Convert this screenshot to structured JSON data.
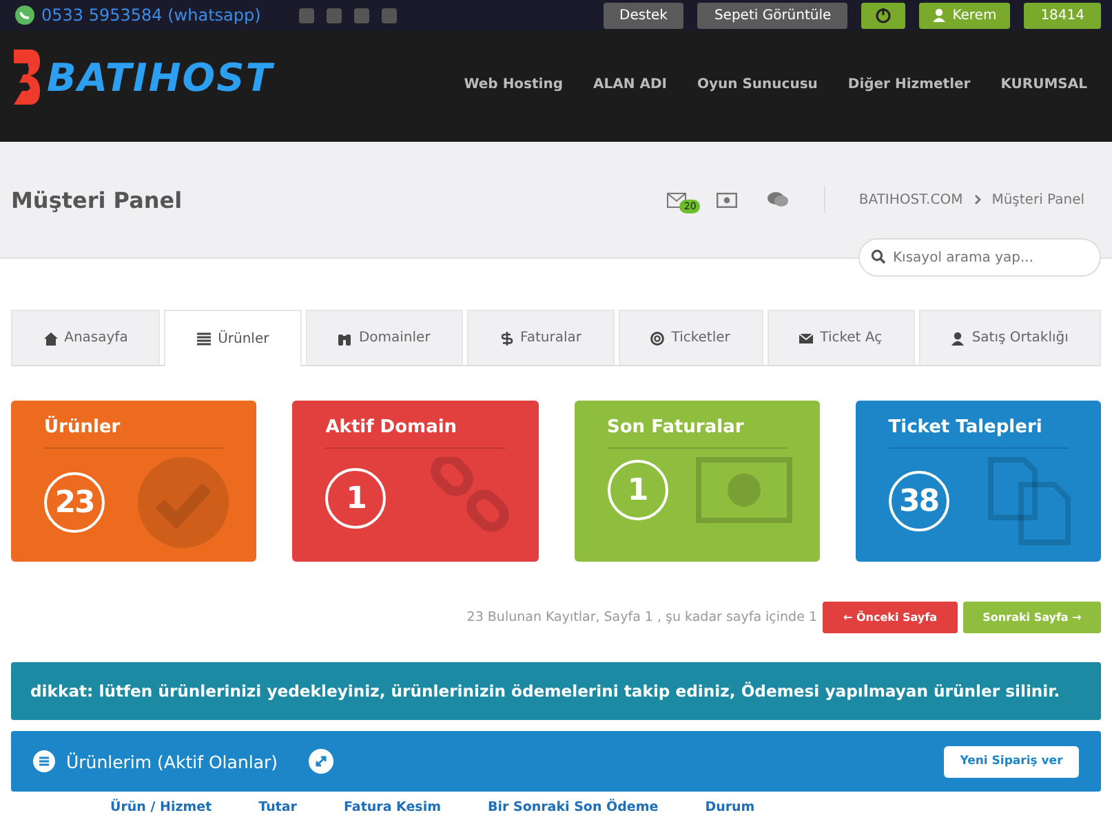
{
  "topbar": {
    "phone": "0533 5953584 (whatsapp)",
    "buttons": [
      {
        "label": "Destek",
        "kind": "grey"
      },
      {
        "label": "Sepeti Görüntüle",
        "kind": "grey"
      },
      {
        "kind": "power"
      },
      {
        "label": "Kerem",
        "kind": "user"
      },
      {
        "label": "18414",
        "kind": "green"
      }
    ]
  },
  "header": {
    "logo": "BATIHOST",
    "nav": [
      "Web Hosting",
      "ALAN ADI",
      "Oyun Sunucusu",
      "Diğer Hizmetler",
      "KURUMSAL"
    ]
  },
  "page_title": "Müşteri Panel",
  "mail_badge": "20",
  "breadcrumb": [
    "BATIHOST.COM",
    "Müşteri Panel"
  ],
  "search": {
    "placeholder": "Kısayol arama yap..."
  },
  "tabs": [
    {
      "label": "Anasayfa",
      "selected": false
    },
    {
      "label": "Ürünler",
      "selected": true
    },
    {
      "label": "Domainler",
      "selected": false
    },
    {
      "label": "Faturalar",
      "selected": false
    },
    {
      "label": "Ticketler",
      "selected": false
    },
    {
      "label": "Ticket Aç",
      "selected": false
    },
    {
      "label": "Satış Ortaklığı",
      "selected": false
    }
  ],
  "stats": [
    {
      "title": "Ürünler",
      "count": "23",
      "color": "#ec6b1f"
    },
    {
      "title": "Aktif Domain",
      "count": "1",
      "color": "#e23f3f"
    },
    {
      "title": "Son Faturalar",
      "count": "1",
      "color": "#8fbd3e"
    },
    {
      "title": "Ticket Talepleri",
      "count": "38",
      "color": "#1c86c8"
    }
  ],
  "pagination": {
    "info": "23 Bulunan Kayıtlar, Sayfa 1 , şu kadar sayfa içinde 1",
    "prev": "← Önceki Sayfa",
    "next": "Sonraki Sayfa →"
  },
  "alert": "dikkat: lütfen ürünlerinizi yedekleyiniz, ürünlerinizin ödemelerini takip ediniz, Ödemesi yapılmayan ürünler silinir.",
  "panel": {
    "title": "Ürünlerim (Aktif Olanlar)",
    "button": "Yeni Sipariş ver"
  },
  "table": {
    "columns": [
      "Ürün / Hizmet",
      "Tutar",
      "Fatura Kesim",
      "Bir Sonraki Son Ödeme",
      "Durum"
    ]
  }
}
